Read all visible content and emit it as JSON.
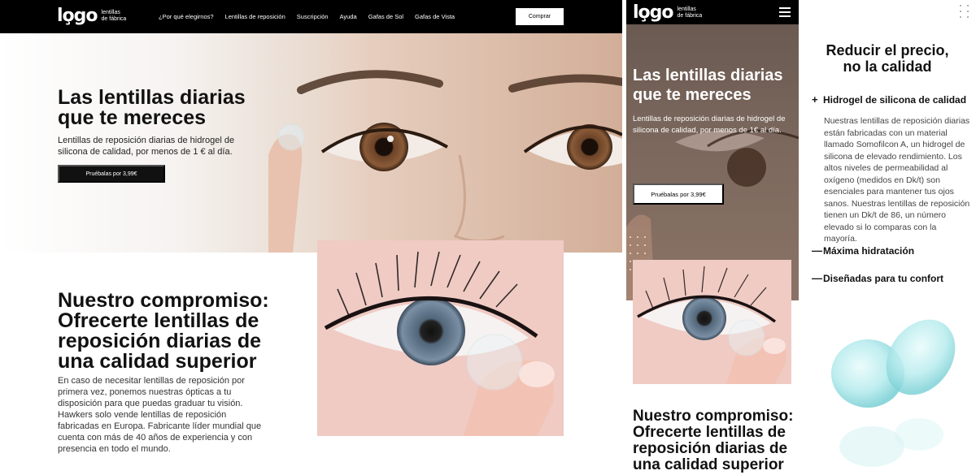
{
  "brand": {
    "mark": "lo̧go",
    "subtitle_line1": "lentillas",
    "subtitle_line2": "de fábrica"
  },
  "nav": {
    "links": [
      "¿Por qué elegirnos?",
      "Lentillas de reposición",
      "Suscripción",
      "Ayuda",
      "Gafas de Sol",
      "Gafas de Vista"
    ],
    "buy_label": "Comprar"
  },
  "hero": {
    "title_line1": "Las lentillas diarias",
    "title_line2": "que te mereces",
    "text": "Lentillas de reposición diarias de hidrogel de silicona de calidad, por menos de 1 € al día.",
    "cta": "Pruébalas por 3,99€"
  },
  "commitment": {
    "title_lines": [
      "Nuestro compromiso:",
      "Ofrecerte lentillas de",
      "reposición diarias de",
      "una calidad superior"
    ],
    "text": "En caso de necesitar lentillas de reposición por primera vez, ponemos nuestras ópticas a tu disposición para que puedas graduar tu visión. Hawkers solo vende lentillas de reposición fabricadas en Europa. Fabricante líder mundial que cuenta con más de 40 años de experiencia y con presencia en todo el mundo."
  },
  "mobile_hero": {
    "title_line1": "Las lentillas diarias",
    "title_line2": "que te mereces",
    "text": "Lentillas de reposición diarias de hidrogel de silicona de calidad, por menos de 1€ al día.",
    "cta": "Pruébalas por 3,99€"
  },
  "mobile_commitment": {
    "title_lines": [
      "Nuestro compromiso:",
      "Ofrecerte lentillas de",
      "reposición diarias de",
      "una calidad superior"
    ]
  },
  "features": {
    "title_line1": "Reducir el precio,",
    "title_line2": "no la calidad",
    "items": [
      {
        "symbol": "+",
        "label": "Hidrogel de silicona de calidad"
      },
      {
        "symbol": "—",
        "label": "Máxima hidratación"
      },
      {
        "symbol": "—",
        "label": "Diseñadas para tu confort"
      }
    ],
    "body": "Nuestras lentillas de reposición diarias están fabricadas con un material llamado Somofilcon A, un hidrogel de silicona de elevado rendimiento. Los altos niveles de permeabilidad al oxígeno (medidos en Dk/t) son esenciales para mantener tus ojos sanos. Nuestras lentillas de reposición tienen un Dk/t de 86, un número elevado si lo comparas con la mayoría."
  },
  "colors": {
    "nav_bg": "#000000",
    "accent": "#111111",
    "lens": "#9fe3e6"
  },
  "icons": {
    "menu": "hamburger-icon",
    "plus": "plus-icon",
    "minus": "minus-icon"
  }
}
